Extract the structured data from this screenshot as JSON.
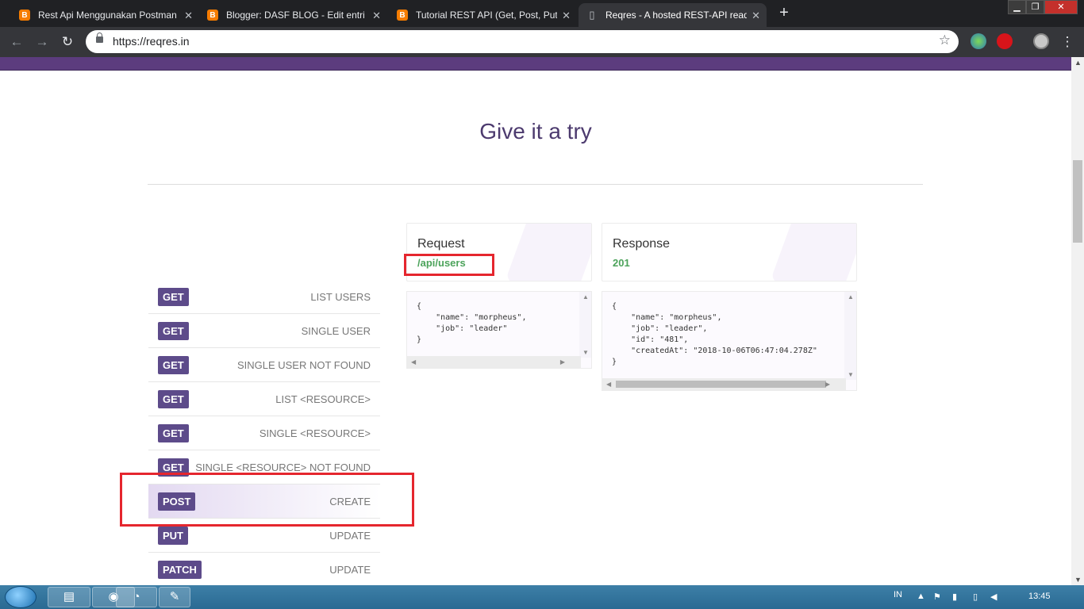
{
  "browser": {
    "tabs": [
      {
        "title": "Rest Api Menggunakan Postman",
        "icon": "blogger-icon"
      },
      {
        "title": "Blogger: DASF BLOG - Edit entri",
        "icon": "blogger-icon"
      },
      {
        "title": "Tutorial REST API (Get, Post, Put,",
        "icon": "blogger-icon"
      },
      {
        "title": "Reqres - A hosted REST-API ready",
        "icon": "document-icon"
      }
    ],
    "address": "https://reqres.in"
  },
  "section": {
    "title": "Give it a try"
  },
  "endpoints": [
    {
      "method": "GET",
      "label": "LIST USERS"
    },
    {
      "method": "GET",
      "label": "SINGLE USER"
    },
    {
      "method": "GET",
      "label": "SINGLE USER NOT FOUND"
    },
    {
      "method": "GET",
      "label": "LIST <RESOURCE>"
    },
    {
      "method": "GET",
      "label": "SINGLE <RESOURCE>"
    },
    {
      "method": "GET",
      "label": "SINGLE <RESOURCE> NOT FOUND"
    },
    {
      "method": "POST",
      "label": "CREATE"
    },
    {
      "method": "PUT",
      "label": "UPDATE"
    },
    {
      "method": "PATCH",
      "label": "UPDATE"
    }
  ],
  "request": {
    "title": "Request",
    "path": "/api/users",
    "body": "{\n    \"name\": \"morpheus\",\n    \"job\": \"leader\"\n}"
  },
  "response": {
    "title": "Response",
    "status": "201",
    "body": "{\n    \"name\": \"morpheus\",\n    \"job\": \"leader\",\n    \"id\": \"481\",\n    \"createdAt\": \"2018-10-06T06:47:04.278Z\"\n}"
  },
  "taskbar": {
    "lang": "IN",
    "time": "13:45"
  },
  "colors": {
    "accent": "#5d4b8a",
    "success": "#4ca35b",
    "highlight": "#e5262e",
    "banner": "#5c3c7e"
  }
}
